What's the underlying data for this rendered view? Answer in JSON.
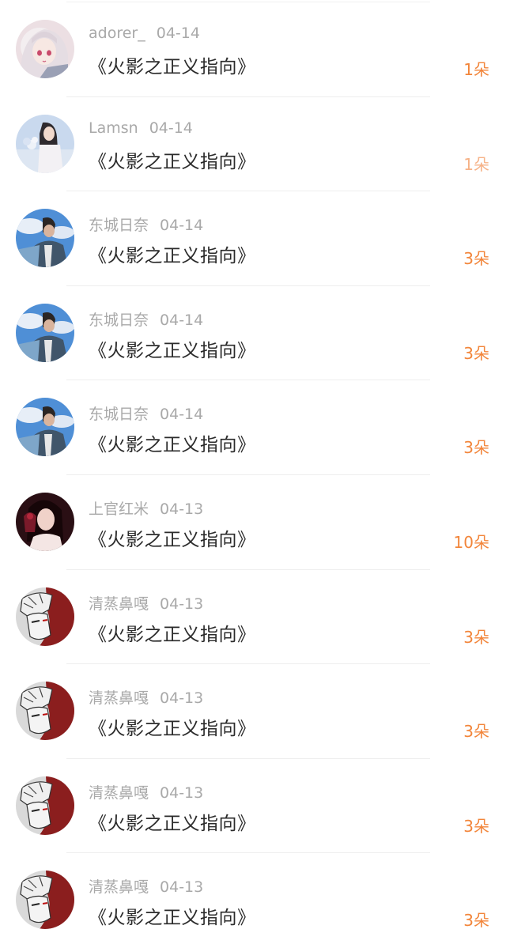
{
  "list": {
    "items": [
      {
        "user": "adorer_",
        "date": "04-14",
        "title": "《火影之正义指向》",
        "gift": "1朵",
        "avatar_icon": "anime-girl-white-hair-avatar"
      },
      {
        "user": "Lamsn",
        "date": "04-14",
        "title": "《火影之正义指向》",
        "gift": "1朵",
        "avatar_icon": "girl-with-flowers-avatar"
      },
      {
        "user": "东城日奈",
        "date": "04-14",
        "title": "《火影之正义指向》",
        "gift": "3朵",
        "avatar_icon": "boy-sky-photo-avatar"
      },
      {
        "user": "东城日奈",
        "date": "04-14",
        "title": "《火影之正义指向》",
        "gift": "3朵",
        "avatar_icon": "boy-sky-photo-avatar"
      },
      {
        "user": "东城日奈",
        "date": "04-14",
        "title": "《火影之正义指向》",
        "gift": "3朵",
        "avatar_icon": "boy-sky-photo-avatar"
      },
      {
        "user": "上官红米",
        "date": "04-13",
        "title": "《火影之正义指向》",
        "gift": "10朵",
        "avatar_icon": "woman-portrait-avatar"
      },
      {
        "user": "清蒸鼻嘎",
        "date": "04-13",
        "title": "《火影之正义指向》",
        "gift": "3朵",
        "avatar_icon": "anime-sketch-red-avatar"
      },
      {
        "user": "清蒸鼻嘎",
        "date": "04-13",
        "title": "《火影之正义指向》",
        "gift": "3朵",
        "avatar_icon": "anime-sketch-red-avatar"
      },
      {
        "user": "清蒸鼻嘎",
        "date": "04-13",
        "title": "《火影之正义指向》",
        "gift": "3朵",
        "avatar_icon": "anime-sketch-red-avatar"
      },
      {
        "user": "清蒸鼻嘎",
        "date": "04-13",
        "title": "《火影之正义指向》",
        "gift": "3朵",
        "avatar_icon": "anime-sketch-red-avatar"
      }
    ]
  },
  "colors": {
    "gift": "#f2853a",
    "meta": "#a9a9a9",
    "title": "#2b2b2b"
  }
}
